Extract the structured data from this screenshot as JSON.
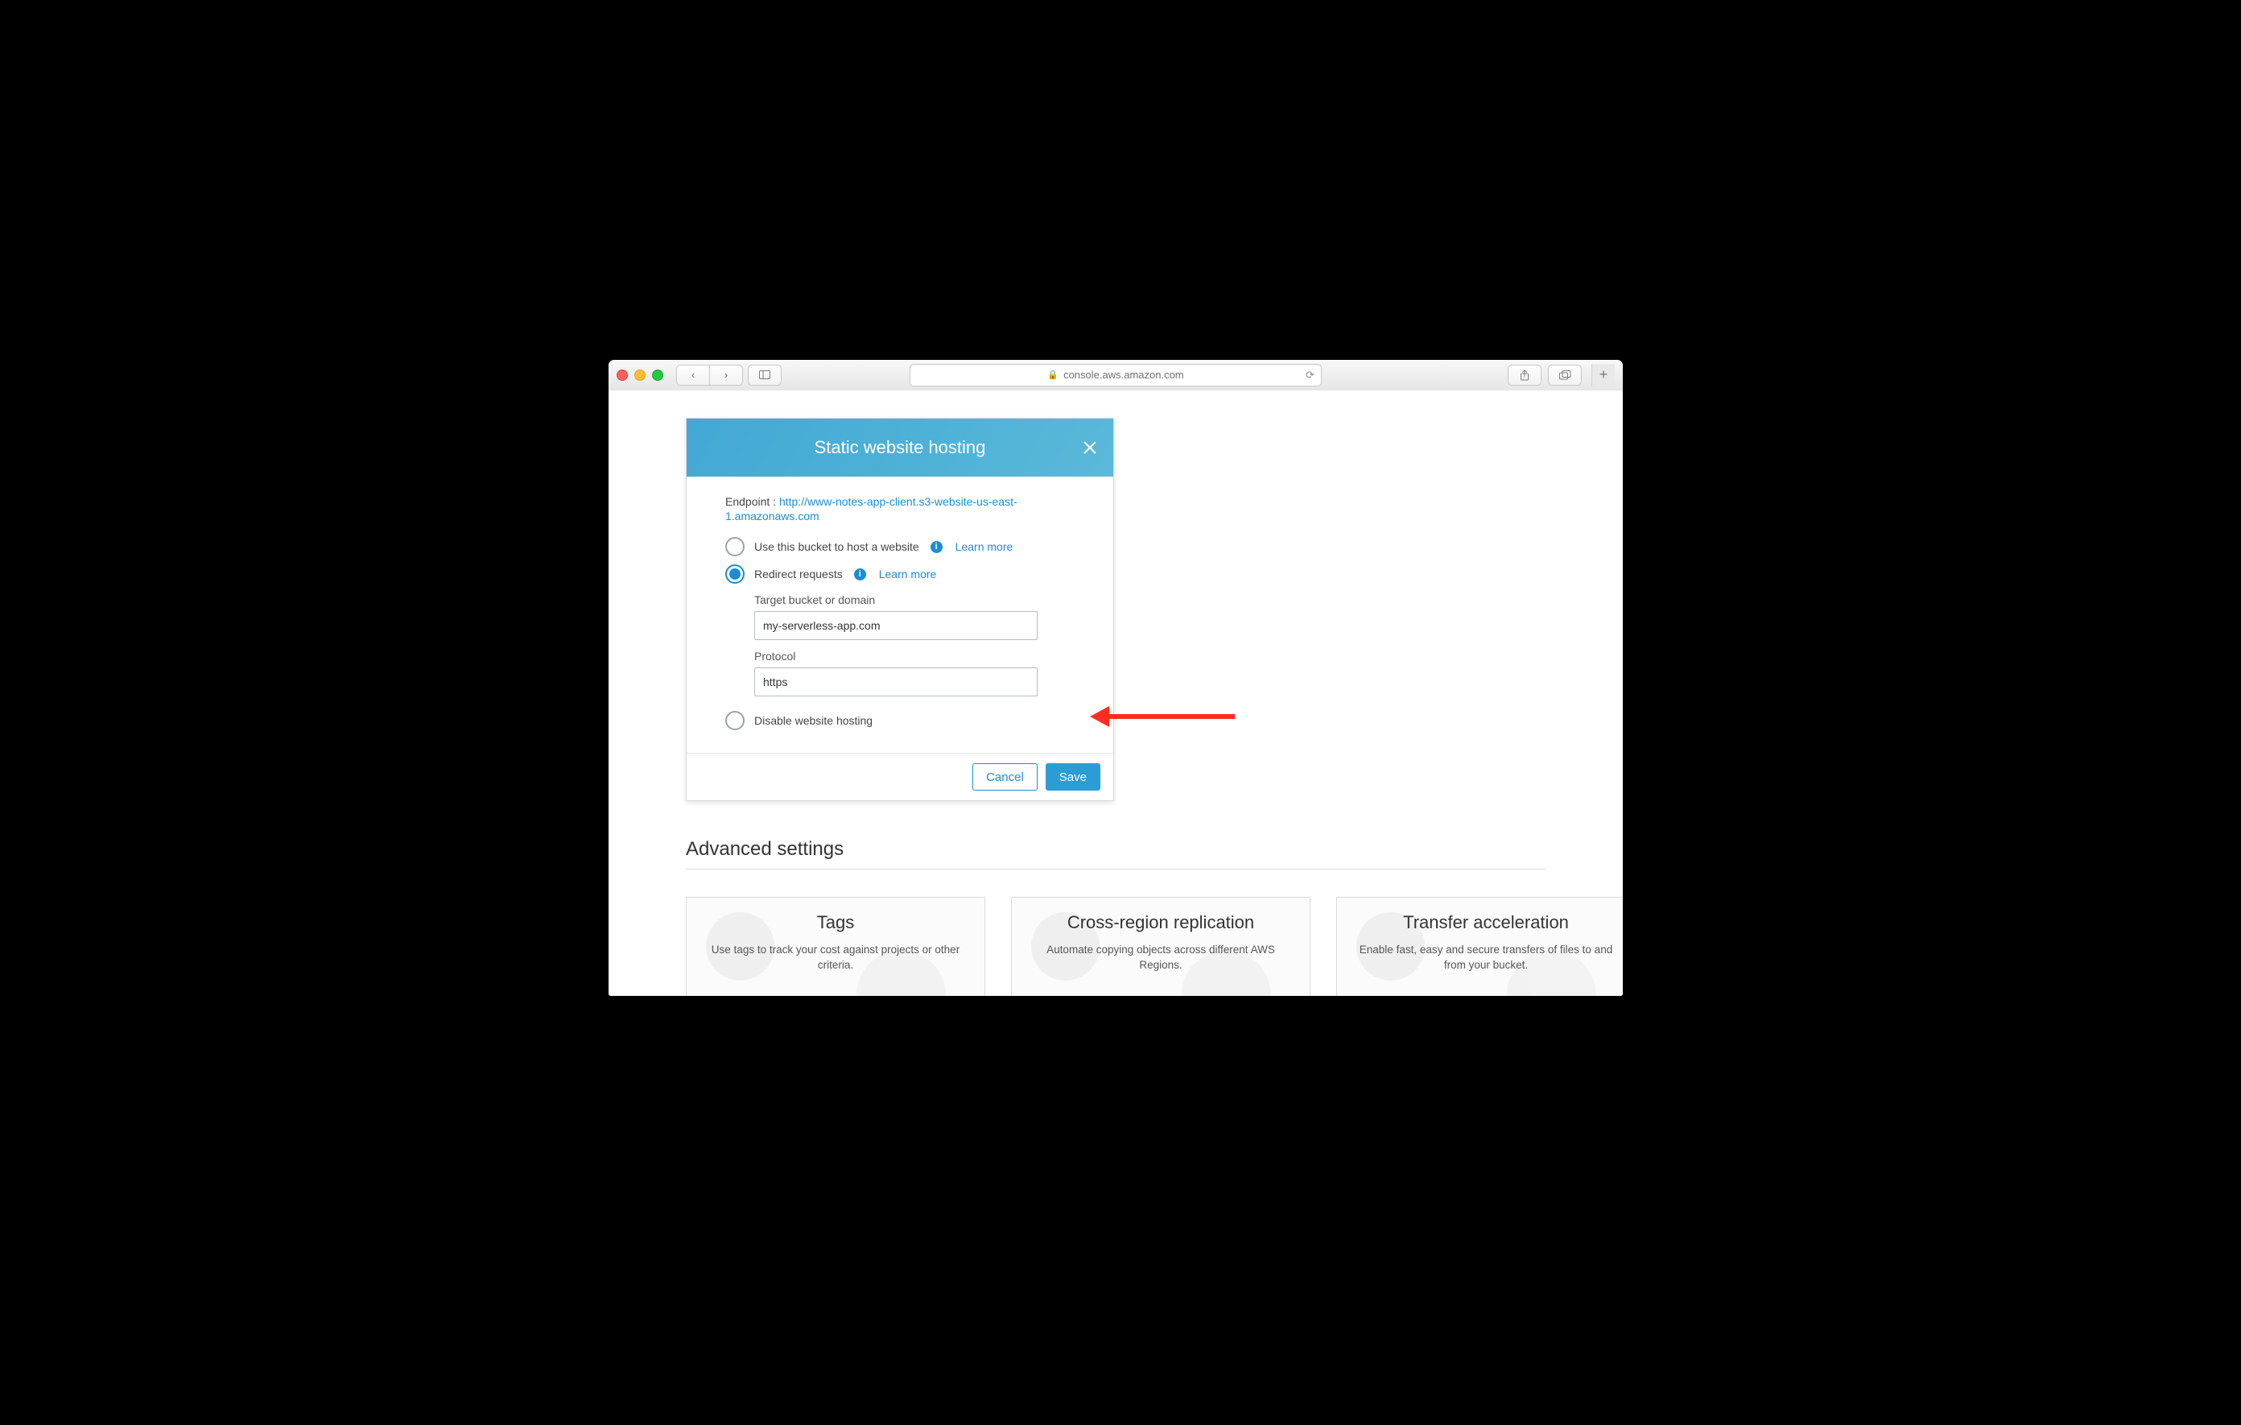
{
  "browser": {
    "address": "console.aws.amazon.com"
  },
  "card": {
    "title": "Static website hosting",
    "endpoint_label": "Endpoint :",
    "endpoint_url": "http://www-notes-app-client.s3-website-us-east-1.amazonaws.com",
    "options": {
      "host": {
        "label": "Use this bucket to host a website",
        "learn_more": "Learn more"
      },
      "redirect": {
        "label": "Redirect requests",
        "learn_more": "Learn more"
      },
      "disable": {
        "label": "Disable website hosting"
      }
    },
    "form": {
      "target_label": "Target bucket or domain",
      "target_value": "my-serverless-app.com",
      "protocol_label": "Protocol",
      "protocol_value": "https"
    },
    "buttons": {
      "cancel": "Cancel",
      "save": "Save"
    }
  },
  "section_title": "Advanced settings",
  "tiles": [
    {
      "title": "Tags",
      "desc": "Use tags to track your cost against projects or other criteria."
    },
    {
      "title": "Cross-region replication",
      "desc": "Automate copying objects across different AWS Regions."
    },
    {
      "title": "Transfer acceleration",
      "desc": "Enable fast, easy and secure transfers of files to and from your bucket."
    }
  ]
}
